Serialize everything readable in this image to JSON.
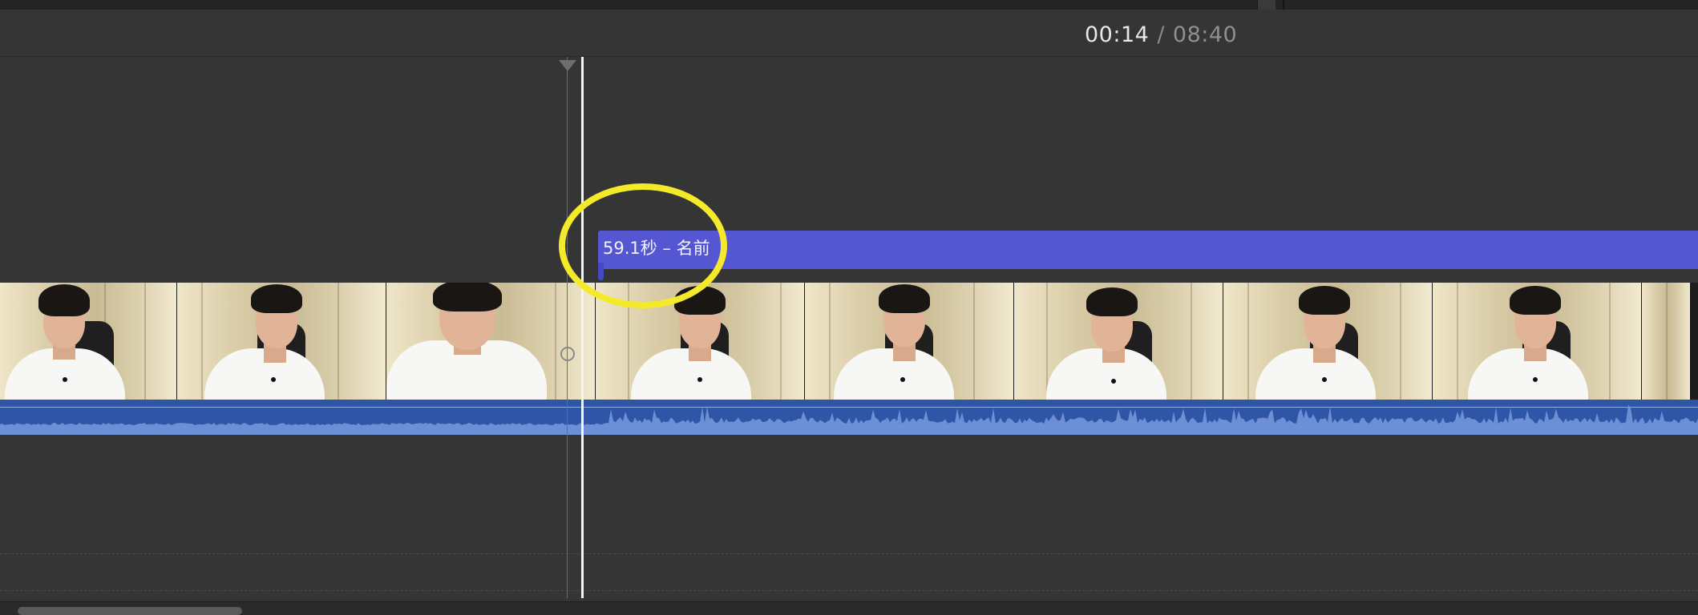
{
  "header": {
    "current_time": "00:14",
    "separator": "/",
    "total_time": "08:40"
  },
  "title_clip": {
    "label": "59.1秒 – 名前",
    "color": "#5557d2"
  },
  "annotation": {
    "ring_color": "#f4ea2a",
    "icon": "highlight-ring"
  },
  "filmstrip": {
    "frames": [
      "frame-1",
      "frame-2",
      "frame-3",
      "frame-4",
      "frame-5",
      "frame-6",
      "frame-7",
      "frame-8",
      "frame-9"
    ]
  },
  "audio": {
    "color": "#2f55a6",
    "waveform_color": "#6d8fd6"
  },
  "colors": {
    "background": "#353535",
    "playhead": "#f4f4f4",
    "skimmer": "#6d6d6d"
  }
}
